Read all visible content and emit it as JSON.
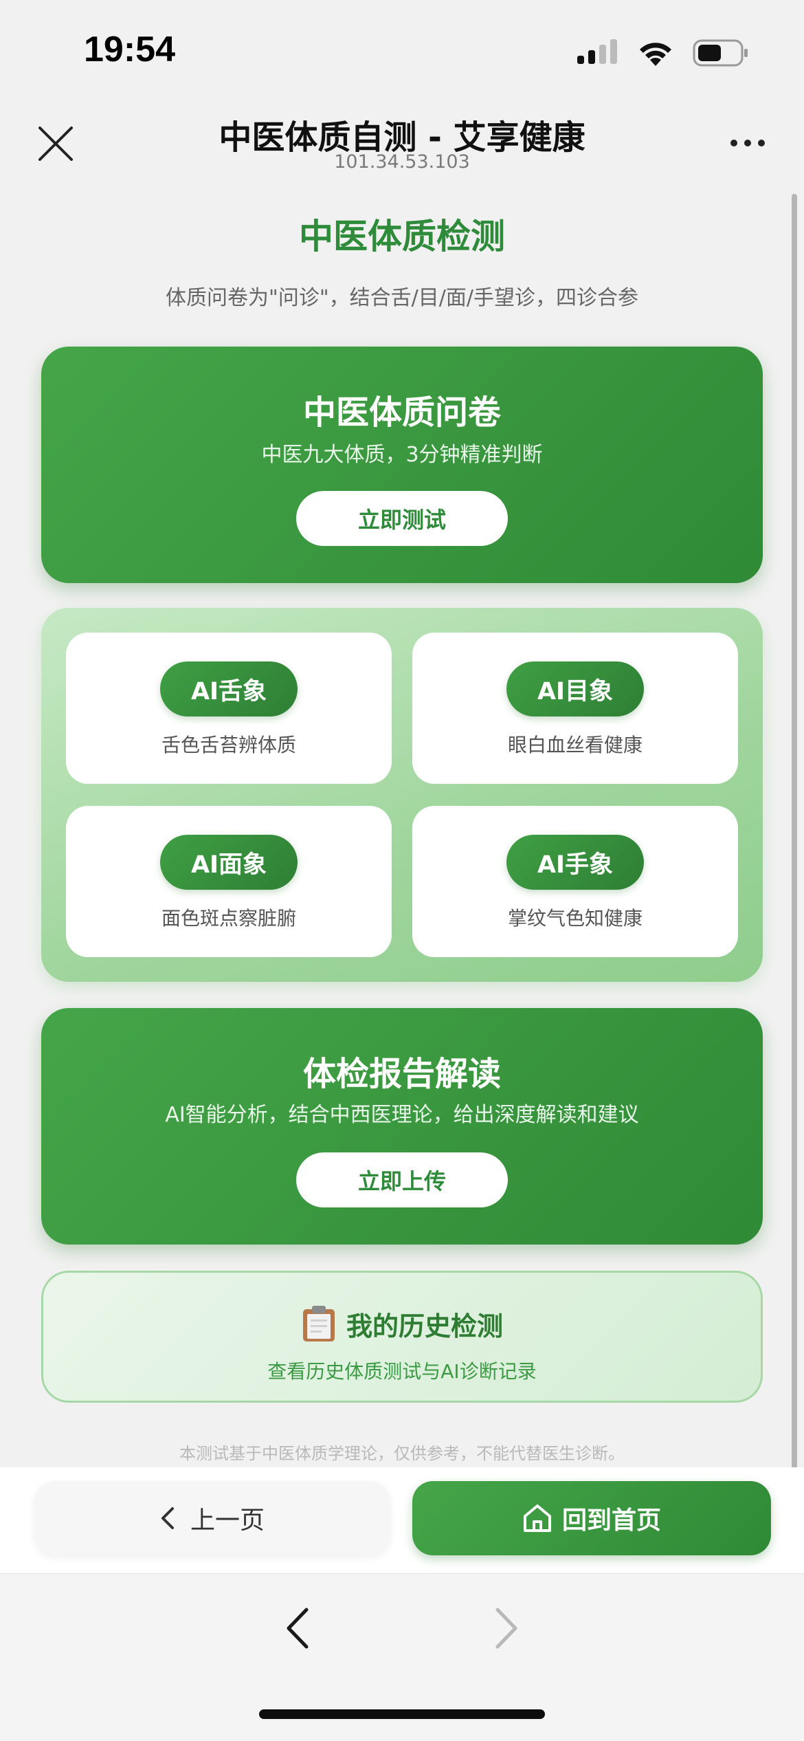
{
  "status_bar": {
    "time": "19:54",
    "icons": [
      "cellular-signal-icon",
      "wifi-icon",
      "battery-icon"
    ]
  },
  "nav": {
    "title": "中医体质自测 - 艾享健康",
    "subtitle": "101.34.53.103",
    "close_icon": "close-icon",
    "more_icon": "more-icon"
  },
  "page": {
    "heading": "中医体质检测",
    "description": "体质问卷为\"问诊\"，结合舌/目/面/手望诊，四诊合参"
  },
  "questionnaire_card": {
    "title": "中医体质问卷",
    "subtitle": "中医九大体质，3分钟精准判断",
    "button": "立即测试"
  },
  "ai_tiles": [
    {
      "label": "AI舌象",
      "desc": "舌色舌苔辨体质"
    },
    {
      "label": "AI目象",
      "desc": "眼白血丝看健康"
    },
    {
      "label": "AI面象",
      "desc": "面色斑点察脏腑"
    },
    {
      "label": "AI手象",
      "desc": "掌纹气色知健康"
    }
  ],
  "report_card": {
    "title": "体检报告解读",
    "subtitle": "AI智能分析，结合中西医理论，给出深度解读和建议",
    "button": "立即上传"
  },
  "history_card": {
    "icon": "clipboard-icon",
    "title": "我的历史检测",
    "subtitle": "查看历史体质测试与AI诊断记录"
  },
  "disclaimer": "本测试基于中医体质学理论，仅供参考，不能代替医生诊断。",
  "actions": {
    "prev": "上一页",
    "home": "回到首页"
  },
  "colors": {
    "primary_green": "#2e8b3a",
    "card_green_light": "#45a548",
    "card_green_dark": "#2f8a36",
    "panel_green": "#a6d8a6"
  }
}
